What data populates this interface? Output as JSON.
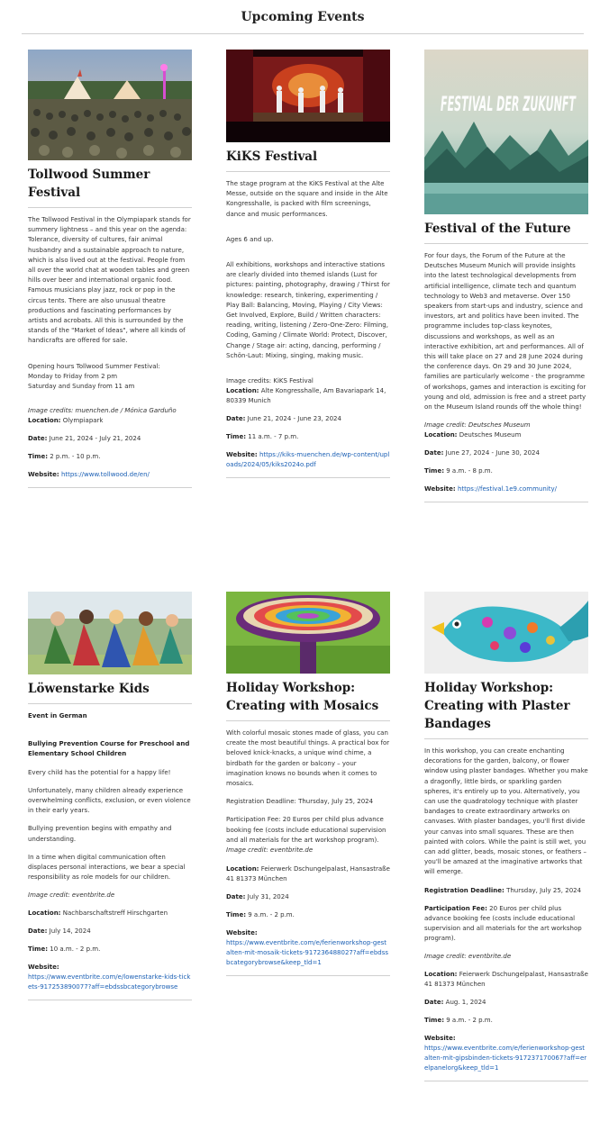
{
  "page": {
    "title": "Upcoming Events"
  },
  "events": [
    {
      "title": "Tollwood Summer Festival",
      "paragraphs": [
        "The Tollwood Festival in the Olympiapark stands for summery lightness – and this year on the agenda: Tolerance, diversity of cultures, fair animal husbandry and a sustainable approach to nature, which is also lived out at the festival. People from all over the world chat at wooden tables and green hills over beer and international organic food. Famous musicians play jazz, rock or pop in the circus tents. There are also unusual theatre productions and fascinating performances by artists and acrobats. All this is surrounded by the stands of the \"Market of Ideas\", where all kinds of handicrafts are offered for sale.",
        "Opening hours Tollwood Summer Festival:",
        "Monday to Friday from 2 pm",
        "Saturday and Sunday from 11 am"
      ],
      "credit": "Image credits: muenchen.de / Mónica Garduño",
      "location_label": "Location:",
      "location": "Olympiapark",
      "date_label": "Date:",
      "date": "June 21, 2024 - July 21, 2024",
      "time_label": "Time:",
      "time": "2 p.m. - 10 p.m.",
      "website_label": "Website:",
      "website": "https://www.tollwood.de/en/"
    },
    {
      "title": "KiKS Festival",
      "paragraphs": [
        "The stage program at the KiKS Festival at the Alte Messe, outside on the square and inside in the Alte Kongresshalle, is packed with film screenings, dance and music performances.",
        "Ages 6 and up.",
        "All exhibitions, workshops and interactive stations are clearly divided into themed islands (Lust for pictures: painting, photography, drawing /  Thirst for knowledge: research, tinkering, experimenting /  Play Ball: Balancing, Moving, Playing /  City Views: Get Involved, Explore, Build /  Written characters: reading, writing, listening /  Zero-One-Zero: Filming, Coding, Gaming /  Climate World: Protect, Discover, Change /  Stage air: acting, dancing, performing /  Schön-Laut: Mixing, singing, making music.",
        "Image credits: KiKS Festival"
      ],
      "location_label": "Location:",
      "location": "Alte Kongresshalle, Am Bavariapark 14, 80339 Munich",
      "date_label": "Date:",
      "date": "June 21, 2024 - June 23, 2024",
      "time_label": "Time:",
      "time": "11 a.m. - 7 p.m.",
      "website_label": "Website:",
      "website": "https://kiks-muenchen.de/wp-content/uploads/2024/05/kiks2024o.pdf"
    },
    {
      "title": "Festival of the Future",
      "image_text": "FESTIVAL DER ZUKUNFT",
      "paragraphs": [
        "For four days, the Forum of the Future at the Deutsches Museum Munich will provide insights into the latest technological developments from artificial intelligence, climate tech and quantum technology to Web3 and metaverse. Over 150 speakers from start-ups and industry, science and investors, art and politics have been invited. The programme includes top-class keynotes, discussions and workshops, as well as an interactive exhibition, art and performances. All of this will take place on 27 and 28 June 2024 during the conference days. On 29 and 30 June 2024, families are particularly welcome - the programme of workshops, games and interaction is exciting for young and old, admission is free and a street party on the Museum Island rounds off the whole thing!"
      ],
      "credit": "Image credit: Deutsches Museum",
      "location_label": "Location:",
      "location": "Deutsches Museum",
      "date_label": "Date:",
      "date": "June 27, 2024 - June 30, 2024",
      "time_label": "Time:",
      "time": "9 a.m. - 8 p.m.",
      "website_label": "Website:",
      "website": "https://festival.1e9.community/"
    },
    {
      "title": "Löwenstarke Kids",
      "subtitle": "Event in German",
      "heading": "Bullying Prevention Course for Preschool and Elementary School Children",
      "paragraphs": [
        "Every child has the potential for a happy life!",
        "Unfortunately, many children already experience overwhelming conflicts, exclusion, or even violence in their early years.",
        "Bullying prevention begins with empathy and understanding.",
        "In a time when digital communication often displaces personal interactions, we bear a special responsibility as role models for our children."
      ],
      "credit": "Image credit: eventbrite.de",
      "location_label": "Location:",
      "location": "Nachbarschaftstreff Hirschgarten",
      "date_label": "Date:",
      "date": "July 14, 2024",
      "time_label": "Time:",
      "time": "10 a.m. - 2 p.m.",
      "website_label": "Website:",
      "website": "https://www.eventbrite.com/e/lowenstarke-kids-tickets-917253890077?aff=ebdssbcategorybrowse"
    },
    {
      "title": "Holiday Workshop: Creating with Mosaics",
      "paragraphs": [
        "With colorful mosaic stones made of glass, you can create the most beautiful things. A practical box for beloved knick-knacks, a unique wind chime, a birdbath for the garden or balcony – your imagination knows no bounds when it comes to mosaics.",
        "Registration Deadline: Thursday, July 25, 2024",
        "Participation Fee: 20 Euros per child plus advance booking fee (costs include educational supervision and all materials for the art workshop program)."
      ],
      "credit": "Image credit: eventbrite.de",
      "location_label": "Location:",
      "location": "Feierwerk Dschungelpalast, Hansastraße 41 81373 München",
      "date_label": "Date:",
      "date": "July 31, 2024",
      "time_label": "Time:",
      "time": "9 a.m. - 2 p.m.",
      "website_label": "Website:",
      "website": "https://www.eventbrite.com/e/ferienworkshop-gestalten-mit-mosaik-tickets-917236488027?aff=ebdssbcategorybrowse&keep_tld=1"
    },
    {
      "title": "Holiday Workshop: Creating with Plaster Bandages",
      "paragraphs": [
        "In this workshop, you can create enchanting decorations for the garden, balcony, or flower window using plaster bandages. Whether you make a dragonfly, little birds, or sparkling garden spheres, it's entirely up to you. Alternatively, you can use the quadratology technique with plaster bandages to create extraordinary artworks on canvases. With plaster bandages, you'll first divide your canvas into small squares. These are then painted with colors. While the paint is still wet, you can add glitter, beads, mosaic stones, or feathers – you'll be amazed at the imaginative artworks that will emerge."
      ],
      "deadline_label": "Registration Deadline:",
      "deadline": "Thursday, July 25, 2024",
      "fee_label": "Participation Fee:",
      "fee": "20 Euros per child plus advance booking fee (costs include educational supervision and all materials for the art workshop program).",
      "credit": "Image credit: eventbrite.de",
      "location_label": "Location:",
      "location": "Feierwerk Dschungelpalast, Hansastraße 41 81373 München",
      "date_label": "Date:",
      "date": "Aug. 1, 2024",
      "time_label": "Time:",
      "time": "9 a.m. - 2 p.m.",
      "website_label": "Website:",
      "website": "https://www.eventbrite.com/e/ferienworkshop-gestalten-mit-gipsbinden-tickets-917237170067?aff=erelpanelorg&keep_tld=1"
    }
  ]
}
